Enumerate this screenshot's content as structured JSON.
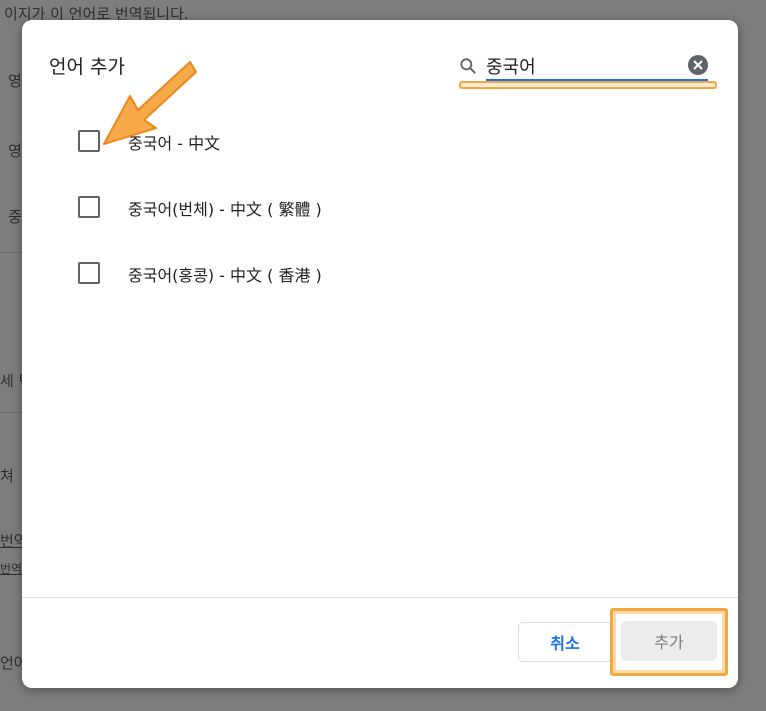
{
  "background": {
    "top_text": "이지가 이 언어로 번역됩니다.",
    "fragments": [
      "영",
      "영",
      "중",
      "세 탁",
      "쳐",
      "번역",
      "번역",
      "언어"
    ]
  },
  "dialog": {
    "title": "언어 추가",
    "search": {
      "value": "중국어",
      "placeholder": ""
    },
    "items": [
      {
        "label": "중국어 - 中文",
        "checked": false
      },
      {
        "label": "중국어(번체) - 中文 ( 繁體 )",
        "checked": false
      },
      {
        "label": "중국어(홍콩) - 中文 ( 香港 )",
        "checked": false
      }
    ],
    "buttons": {
      "cancel": "취소",
      "add": "추가"
    }
  },
  "icons": {
    "search": "search-icon",
    "clear": "clear-icon",
    "checkbox": "checkbox-icon",
    "arrow": "annotation-arrow"
  },
  "colors": {
    "accent": "#1a73e8",
    "highlight": "#f4a640",
    "disabled_button_bg": "#ececec"
  }
}
